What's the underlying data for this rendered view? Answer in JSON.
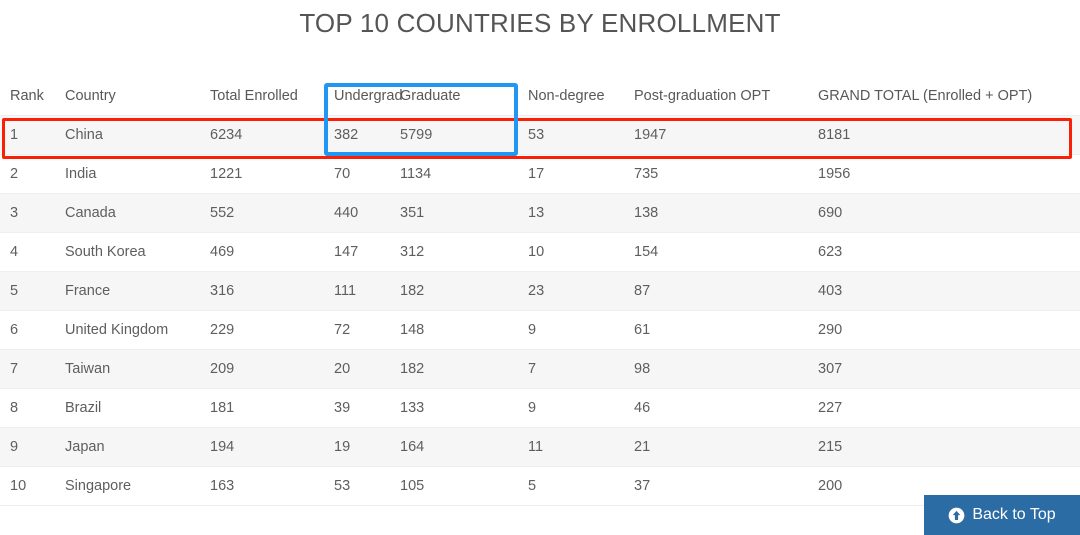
{
  "page": {
    "title": "TOP 10 COUNTRIES BY ENROLLMENT"
  },
  "table": {
    "columns": [
      "Rank",
      "Country",
      "Total Enrolled",
      "Undergrad",
      "Graduate",
      "Non-degree",
      "Post-graduation OPT",
      "GRAND TOTAL (Enrolled + OPT)"
    ],
    "rows": [
      {
        "rank": "1",
        "country": "China",
        "total_enrolled": "6234",
        "undergrad": "382",
        "graduate": "5799",
        "non_degree": "53",
        "opt": "1947",
        "grand_total": "8181"
      },
      {
        "rank": "2",
        "country": "India",
        "total_enrolled": "1221",
        "undergrad": "70",
        "graduate": "1134",
        "non_degree": "17",
        "opt": "735",
        "grand_total": "1956"
      },
      {
        "rank": "3",
        "country": "Canada",
        "total_enrolled": "552",
        "undergrad": "440",
        "graduate": "351",
        "non_degree": "13",
        "opt": "138",
        "grand_total": "690"
      },
      {
        "rank": "4",
        "country": "South Korea",
        "total_enrolled": "469",
        "undergrad": "147",
        "graduate": "312",
        "non_degree": "10",
        "opt": "154",
        "grand_total": "623"
      },
      {
        "rank": "5",
        "country": "France",
        "total_enrolled": "316",
        "undergrad": "111",
        "graduate": "182",
        "non_degree": "23",
        "opt": "87",
        "grand_total": "403"
      },
      {
        "rank": "6",
        "country": "United Kingdom",
        "total_enrolled": "229",
        "undergrad": "72",
        "graduate": "148",
        "non_degree": "9",
        "opt": "61",
        "grand_total": "290"
      },
      {
        "rank": "7",
        "country": "Taiwan",
        "total_enrolled": "209",
        "undergrad": "20",
        "graduate": "182",
        "non_degree": "7",
        "opt": "98",
        "grand_total": "307"
      },
      {
        "rank": "8",
        "country": "Brazil",
        "total_enrolled": "181",
        "undergrad": "39",
        "graduate": "133",
        "non_degree": "9",
        "opt": "46",
        "grand_total": "227"
      },
      {
        "rank": "9",
        "country": "Japan",
        "total_enrolled": "194",
        "undergrad": "19",
        "graduate": "164",
        "non_degree": "11",
        "opt": "21",
        "grand_total": "215"
      },
      {
        "rank": "10",
        "country": "Singapore",
        "total_enrolled": "163",
        "undergrad": "53",
        "graduate": "105",
        "non_degree": "5",
        "opt": "37",
        "grand_total": "200"
      }
    ]
  },
  "annotations": {
    "row_highlight": {
      "target": "China",
      "color": "#fa2008"
    },
    "column_highlight": {
      "targets": "Undergrad, Graduate",
      "color": "#2196f3"
    }
  },
  "back_to_top": {
    "label": "Back to Top",
    "icon": "arrow-circle-up-icon",
    "color": "#2c6ca4"
  }
}
